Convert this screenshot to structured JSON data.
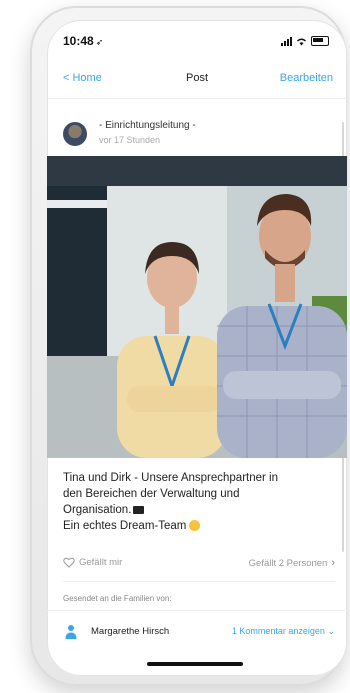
{
  "status_bar": {
    "time": "10:48"
  },
  "nav": {
    "back_label": "< Home",
    "title": "Post",
    "edit_label": "Bearbeiten"
  },
  "post": {
    "author": "- Einrichtungsleitung -",
    "time_ago": "vor 17 Stunden",
    "caption_lines": [
      "Tina und Dirk - Unsere Ansprechpartner in",
      "den Bereichen der Verwaltung und",
      "Organisation.",
      "Ein echtes Dream-Team"
    ],
    "like_label": "Gefällt mir",
    "likes_count_label": "Gefällt 2 Personen"
  },
  "recipients": {
    "heading": "Gesendet an die Familien von:",
    "family_name": "Margarethe Hirsch",
    "comments_link": "1 Kommentar anzeigen"
  },
  "colors": {
    "accent": "#3aa6e8"
  }
}
